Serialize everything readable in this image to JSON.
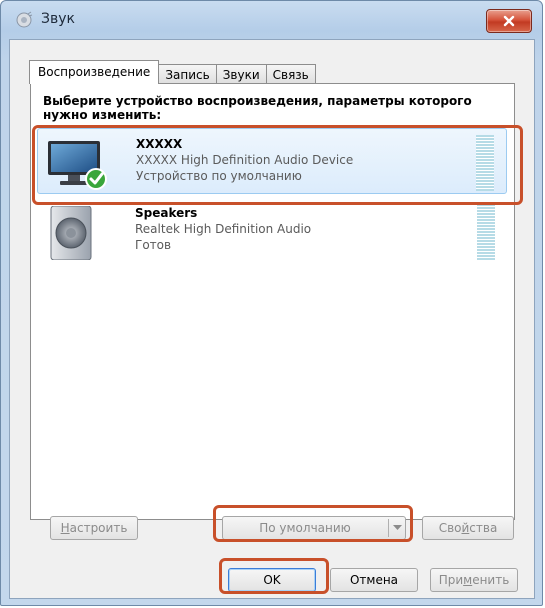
{
  "window": {
    "title": "Звук",
    "close_label": "x"
  },
  "tabs": [
    {
      "label": "Воспроизведение",
      "active": true
    },
    {
      "label": "Запись"
    },
    {
      "label": "Звуки"
    },
    {
      "label": "Связь"
    }
  ],
  "instruction": "Выберите устройство воспроизведения, параметры которого нужно изменить:",
  "devices": [
    {
      "name": "XXXXX",
      "description": "XXXXX High Definition Audio Device",
      "status": "Устройство по умолчанию",
      "icon": "monitor-icon",
      "default": true
    },
    {
      "name": "Speakers",
      "description": "Realtek High Definition Audio",
      "status": "Готов",
      "icon": "speaker-icon"
    }
  ],
  "buttons": {
    "configure": {
      "prefix": "",
      "u": "Н",
      "suffix": "астроить"
    },
    "set_default": "По умолчанию",
    "properties": {
      "prefix": "Сво",
      "u": "й",
      "suffix": "ства"
    },
    "ok": "OK",
    "cancel": "Отмена",
    "apply": {
      "prefix": "При",
      "u": "м",
      "suffix": "енить"
    }
  },
  "colors": {
    "highlight": "#c8502a",
    "close_button": "#c23a22",
    "meter": "#b6dbe6",
    "selection": "#dcecfc"
  }
}
